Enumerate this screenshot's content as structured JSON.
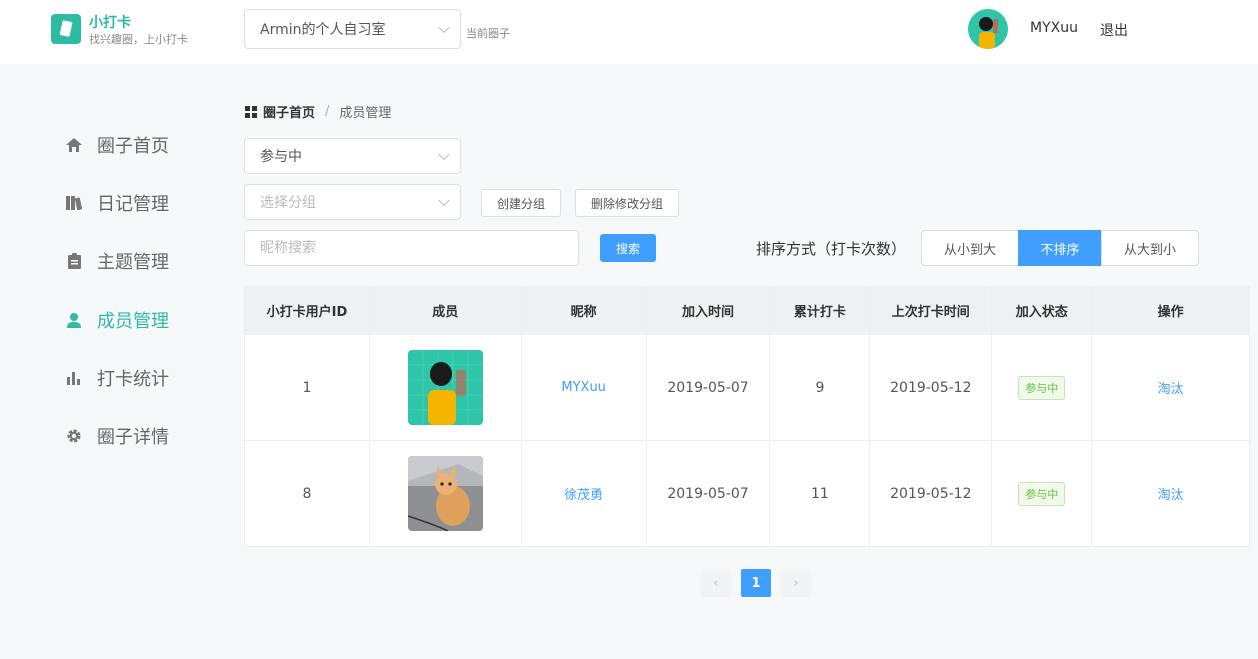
{
  "app": {
    "name": "小打卡",
    "slogan": "找兴趣圈，上小打卡"
  },
  "header": {
    "circle_select_value": "Armin的个人自习室",
    "circle_label": "当前圈子",
    "username": "MYXuu",
    "logout_label": "退出"
  },
  "sidebar": {
    "items": [
      {
        "label": "圈子首页",
        "icon": "home-icon"
      },
      {
        "label": "日记管理",
        "icon": "book-icon"
      },
      {
        "label": "主题管理",
        "icon": "clipboard-icon"
      },
      {
        "label": "成员管理",
        "icon": "user-icon",
        "active": true
      },
      {
        "label": "打卡统计",
        "icon": "bar-chart-icon"
      },
      {
        "label": "圈子详情",
        "icon": "gear-icon"
      }
    ]
  },
  "breadcrumb": {
    "home": "圈子首页",
    "separator": "/",
    "current": "成员管理"
  },
  "filters": {
    "status_value": "参与中",
    "group_placeholder": "选择分组",
    "create_group_label": "创建分组",
    "edit_group_label": "删除修改分组",
    "search_placeholder": "昵称搜索",
    "search_label": "搜索"
  },
  "sort": {
    "label": "排序方式（打卡次数）",
    "options": [
      "从小到大",
      "不排序",
      "从大到小"
    ],
    "active_index": 1
  },
  "table": {
    "headers": [
      "小打卡用户ID",
      "成员",
      "昵称",
      "加入时间",
      "累计打卡",
      "上次打卡时间",
      "加入状态",
      "操作"
    ],
    "rows": [
      {
        "id": "1",
        "nickname": "MYXuu",
        "join_date": "2019-05-07",
        "total": "9",
        "last_date": "2019-05-12",
        "status": "参与中",
        "action": "淘汰"
      },
      {
        "id": "8",
        "nickname": "徐茂勇",
        "join_date": "2019-05-07",
        "total": "11",
        "last_date": "2019-05-12",
        "status": "参与中",
        "action": "淘汰"
      }
    ]
  },
  "pagination": {
    "prev": "‹",
    "current": "1",
    "next": "›"
  },
  "colors": {
    "brand": "#2dbba4",
    "primary": "#409eff",
    "success": "#67c23a"
  }
}
